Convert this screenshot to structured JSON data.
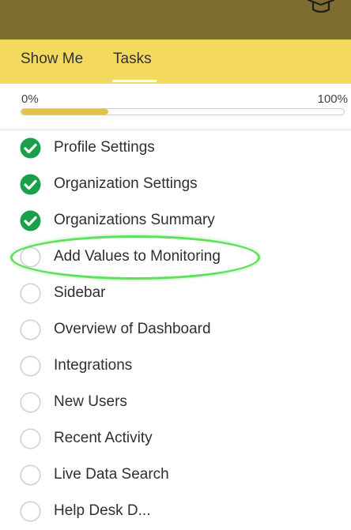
{
  "header": {
    "icon": "graduation-cap-icon"
  },
  "tabs": [
    {
      "label": "Show Me"
    },
    {
      "label": "Tasks",
      "active": true
    }
  ],
  "progress": {
    "min_label": "0%",
    "max_label": "100%",
    "value": 0.27
  },
  "tasks": [
    {
      "label": "Profile Settings",
      "done": true
    },
    {
      "label": "Organization Settings",
      "done": true
    },
    {
      "label": "Organizations Summary",
      "done": true
    },
    {
      "label": "Add Values to Monitoring",
      "done": false,
      "highlighted": true
    },
    {
      "label": "Sidebar",
      "done": false
    },
    {
      "label": "Overview of Dashboard",
      "done": false
    },
    {
      "label": "Integrations",
      "done": false
    },
    {
      "label": "New Users",
      "done": false
    },
    {
      "label": "Recent Activity",
      "done": false
    },
    {
      "label": "Live Data Search",
      "done": false
    },
    {
      "label": "Help Desk D...",
      "done": false
    }
  ],
  "colors": {
    "header": "#7f6c2f",
    "tab_bar": "#f3d95d",
    "progress_fill": "#e4c24a",
    "check_done": "#1aa04a",
    "highlight": "#5de05a"
  }
}
